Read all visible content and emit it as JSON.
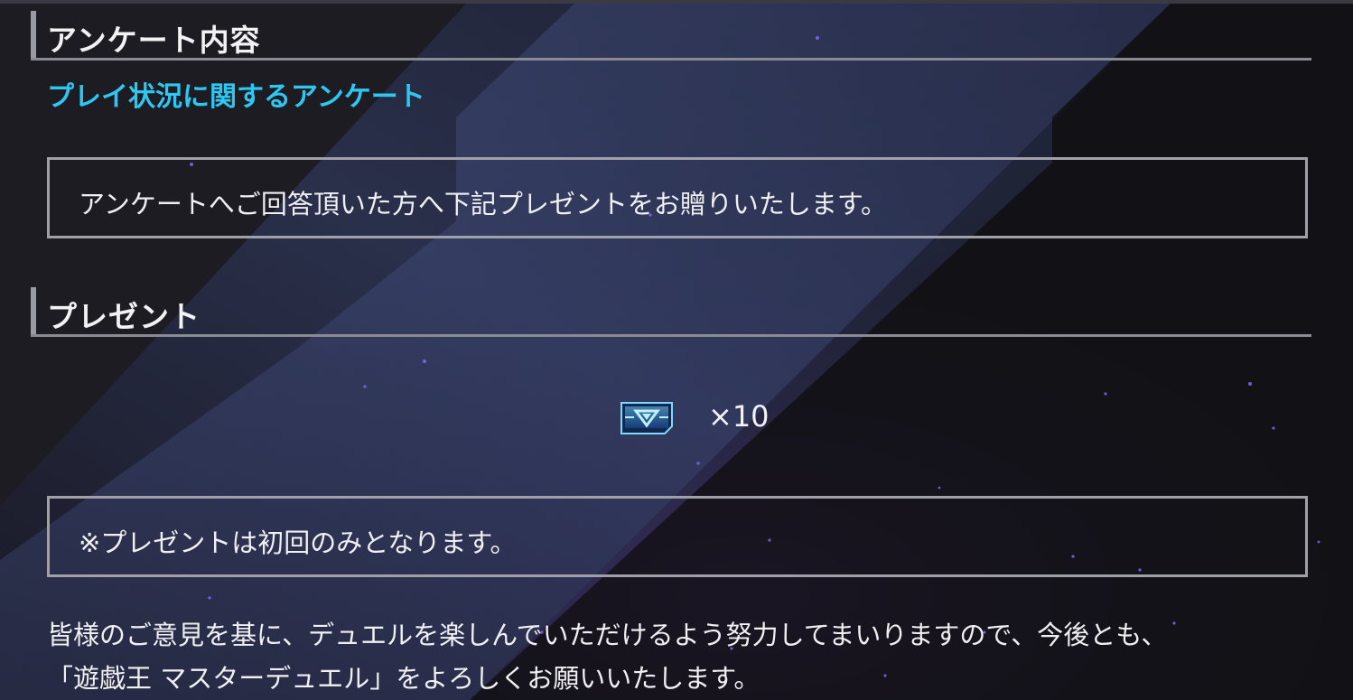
{
  "sections": {
    "survey": {
      "header": "アンケート内容",
      "link_label": "プレイ状況に関するアンケート",
      "notice": "アンケートへご回答頂いた方へ下記プレゼントをお贈りいたします。"
    },
    "present": {
      "header": "プレゼント",
      "item_icon": "ticket-icon",
      "item_count": "×10",
      "note": "※プレゼントは初回のみとなります。"
    }
  },
  "footer": {
    "line1": "皆様のご意見を基に、デュエルを楽しんでいただけるよう努力してまいりますので、今後とも、",
    "line2": "「遊戯王 マスターデュエル」をよろしくお願いいたします。"
  },
  "colors": {
    "link": "#2ec7f2",
    "accent_band": "#3c4a78",
    "background": "#0f0f14"
  }
}
